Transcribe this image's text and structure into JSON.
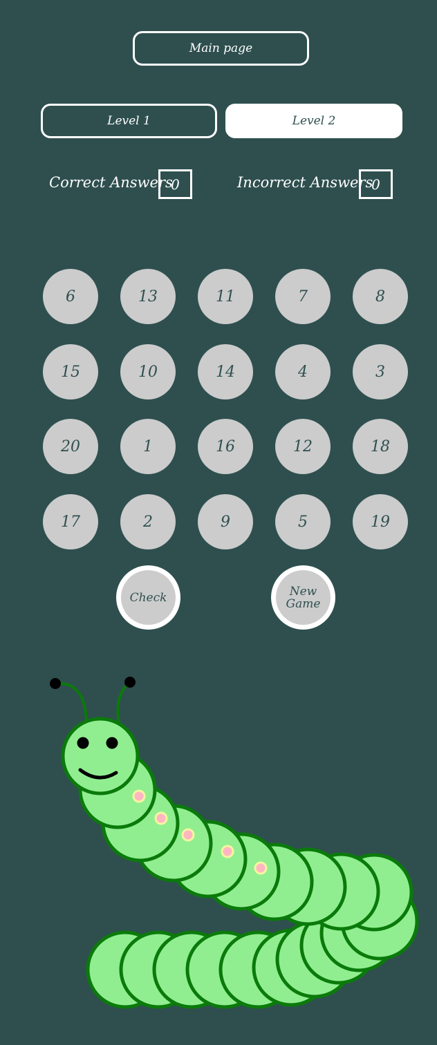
{
  "header": {
    "main_page_label": "Main page"
  },
  "levels": {
    "level1_label": "Level 1",
    "level2_label": "Level 2",
    "selected": "Level 2"
  },
  "score": {
    "correct_label": "Correct Answers",
    "correct_value": "0",
    "incorrect_label": "Incorrect Answers",
    "incorrect_value": "0"
  },
  "grid": {
    "rows": [
      [
        "6",
        "13",
        "11",
        "7",
        "8"
      ],
      [
        "15",
        "10",
        "14",
        "4",
        "3"
      ],
      [
        "20",
        "1",
        "16",
        "12",
        "18"
      ],
      [
        "17",
        "2",
        "9",
        "5",
        "19"
      ]
    ]
  },
  "actions": {
    "check_label": "Check",
    "new_game_label": "New Game"
  },
  "colors": {
    "background": "#2f4f4f",
    "tile": "#cccccc",
    "tile_text": "#2f4f4f",
    "caterpillar_body": "#90ee90",
    "caterpillar_outline": "#0a7a0a",
    "spot": "#ffb6c1"
  }
}
